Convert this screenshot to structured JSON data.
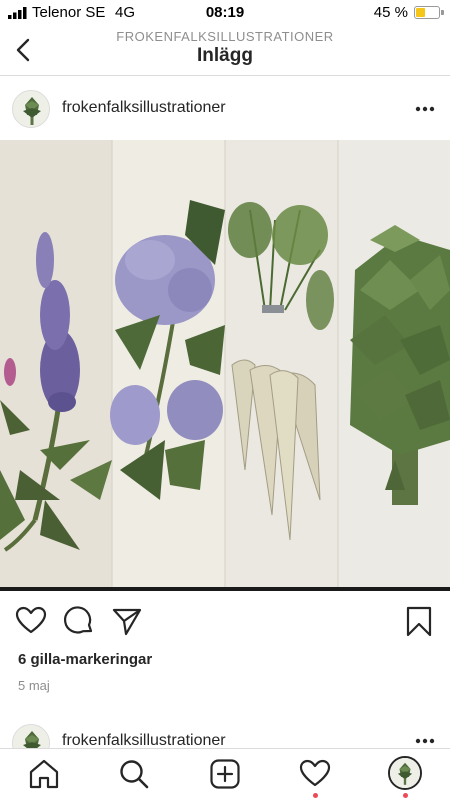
{
  "status_bar": {
    "carrier": "Telenor SE",
    "network": "4G",
    "time": "08:19",
    "battery_percent_label": "45 %",
    "battery_level": 0.45,
    "battery_color": "#f5c518"
  },
  "nav": {
    "back_icon": "chevron-left-icon",
    "account": "FROKENFALKSILLUSTRATIONER",
    "title": "Inlägg"
  },
  "post": {
    "username": "frokenfalksillustrationer",
    "more_icon": "ellipsis-icon",
    "image_subjects": [
      "lupine",
      "hydrangea",
      "parsnip",
      "artichoke"
    ],
    "actions": {
      "like_icon": "heart-icon",
      "comment_icon": "comment-icon",
      "share_icon": "send-icon",
      "save_icon": "bookmark-icon"
    },
    "likes": "6 gilla-markeringar",
    "date": "5 maj"
  },
  "next_post": {
    "username": "frokenfalksillustrationer"
  },
  "tab_bar": {
    "items": [
      "home-icon",
      "search-icon",
      "new-post-icon",
      "activity-icon",
      "profile-avatar"
    ],
    "notification_color": "#ed4956"
  }
}
